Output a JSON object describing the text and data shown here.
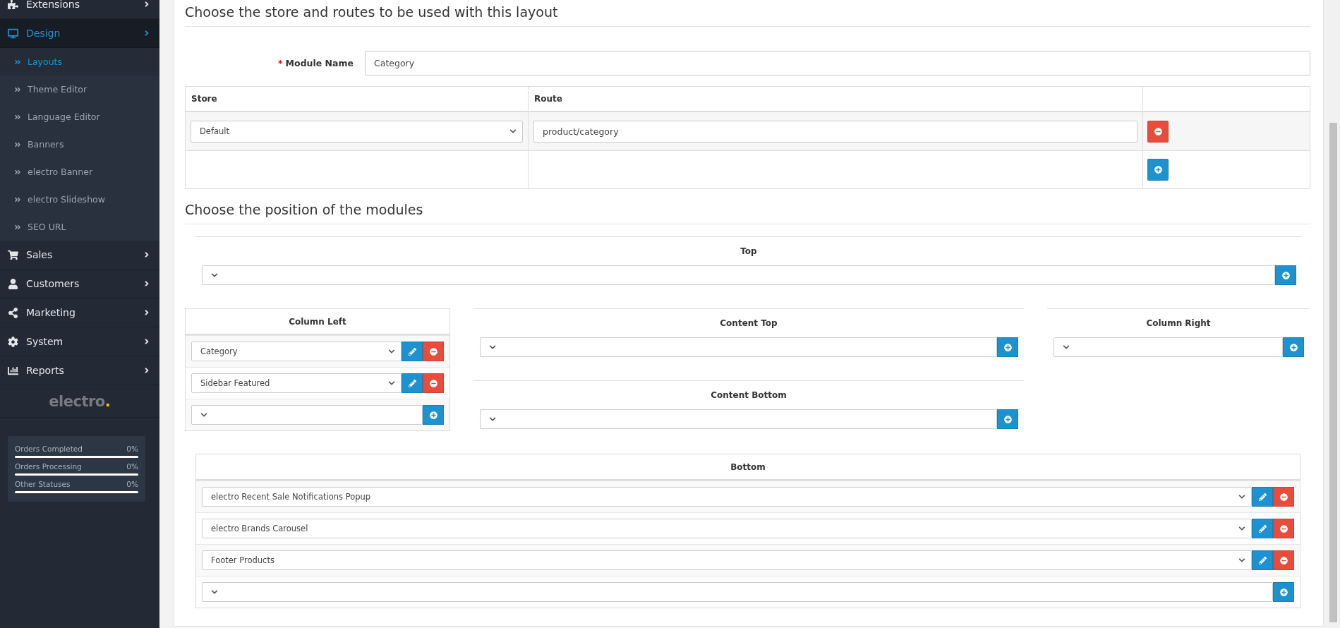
{
  "sidebar": {
    "items": [
      {
        "label": "Extensions",
        "selected": false
      },
      {
        "label": "Design",
        "selected": true,
        "expanded": true,
        "children": [
          {
            "label": "Layouts",
            "selected": true
          },
          {
            "label": "Theme Editor",
            "selected": false
          },
          {
            "label": "Language Editor",
            "selected": false
          },
          {
            "label": "Banners",
            "selected": false
          },
          {
            "label": "electro Banner",
            "selected": false
          },
          {
            "label": "electro Slideshow",
            "selected": false
          },
          {
            "label": "SEO URL",
            "selected": false
          }
        ]
      },
      {
        "label": "Sales",
        "selected": false
      },
      {
        "label": "Customers",
        "selected": false
      },
      {
        "label": "Marketing",
        "selected": false
      },
      {
        "label": "System",
        "selected": false
      },
      {
        "label": "Reports",
        "selected": false
      }
    ],
    "logo": {
      "name": "electro",
      "mark": "."
    },
    "stats": [
      {
        "label": "Orders Completed",
        "value": "0%",
        "level": 0
      },
      {
        "label": "Orders Processing",
        "value": "0%",
        "level": 0
      },
      {
        "label": "Other Statuses",
        "value": "0%",
        "level": 0
      }
    ]
  },
  "store_section": {
    "heading": "Choose the store and routes to be used with this layout",
    "module_name": {
      "required_mark": "*",
      "label": "Module Name",
      "value": "Category"
    },
    "table": {
      "columns": [
        "Store",
        "Route"
      ],
      "rows": [
        {
          "store": "Default",
          "route": "product/category"
        }
      ]
    }
  },
  "positions_section": {
    "heading": "Choose the position of the modules",
    "top": {
      "title": "Top"
    },
    "column_left": {
      "title": "Column Left",
      "modules": [
        {
          "value": "Category"
        },
        {
          "value": "Sidebar Featured"
        }
      ]
    },
    "content_top": {
      "title": "Content Top"
    },
    "content_bottom": {
      "title": "Content Bottom"
    },
    "column_right": {
      "title": "Column Right"
    },
    "bottom": {
      "title": "Bottom",
      "modules": [
        {
          "value": "electro Recent Sale Notifications Popup"
        },
        {
          "value": "electro Brands Carousel"
        },
        {
          "value": "Footer Products"
        }
      ]
    }
  }
}
